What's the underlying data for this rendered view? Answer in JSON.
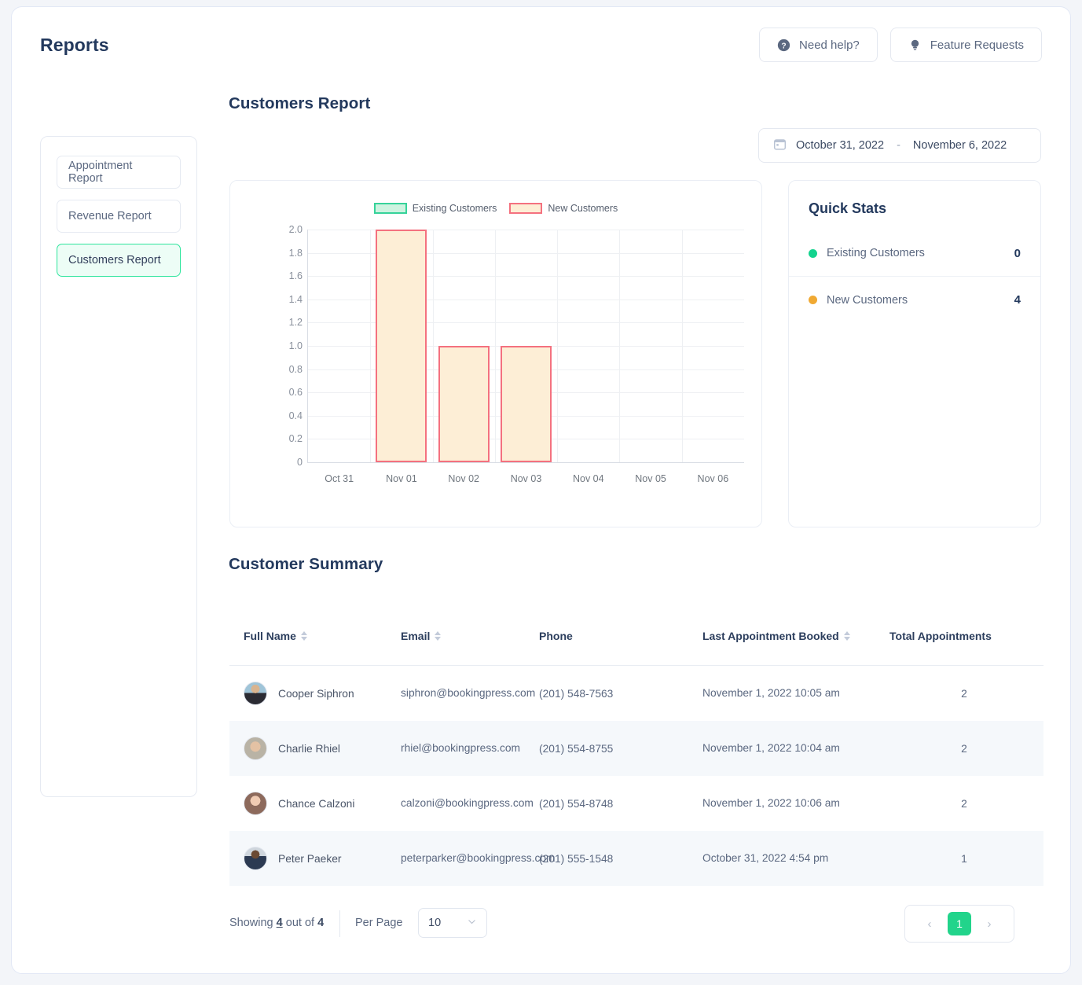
{
  "header": {
    "title": "Reports",
    "need_help_label": "Need help?",
    "feature_requests_label": "Feature Requests"
  },
  "sidebar": {
    "items": [
      {
        "label": "Appointment Report",
        "active": false
      },
      {
        "label": "Revenue Report",
        "active": false
      },
      {
        "label": "Customers Report",
        "active": true
      }
    ]
  },
  "main": {
    "report_title": "Customers Report",
    "summary_title": "Customer Summary"
  },
  "daterange": {
    "start": "October 31, 2022",
    "separator": "-",
    "end": "November 6, 2022"
  },
  "quick_stats": {
    "title": "Quick Stats",
    "rows": [
      {
        "label": "Existing Customers",
        "value": "0",
        "color": "#13d38e"
      },
      {
        "label": "New Customers",
        "value": "4",
        "color": "#f0a933"
      }
    ]
  },
  "chart_data": {
    "type": "bar",
    "title": "",
    "xlabel": "",
    "ylabel": "",
    "categories": [
      "Oct 31",
      "Nov 01",
      "Nov 02",
      "Nov 03",
      "Nov 04",
      "Nov 05",
      "Nov 06"
    ],
    "series": [
      {
        "name": "Existing Customers",
        "values": [
          0,
          0,
          0,
          0,
          0,
          0,
          0
        ],
        "fill": "#cdf3e0",
        "stroke": "#36d39a"
      },
      {
        "name": "New Customers",
        "values": [
          0,
          2,
          1,
          1,
          0,
          0,
          0
        ],
        "fill": "#fdeed6",
        "stroke": "#f4717f"
      }
    ],
    "ylim": [
      0,
      2.0
    ],
    "yticks": [
      "2.0",
      "1.8",
      "1.6",
      "1.4",
      "1.2",
      "1.0",
      "0.8",
      "0.6",
      "0.4",
      "0.2",
      "0"
    ],
    "ytick_values": [
      2.0,
      1.8,
      1.6,
      1.4,
      1.2,
      1.0,
      0.8,
      0.6,
      0.4,
      0.2,
      0
    ],
    "grid": true,
    "legend": [
      "Existing Customers",
      "New Customers"
    ],
    "legend_position": "top-center"
  },
  "table": {
    "columns": [
      {
        "label": "Full Name",
        "sortable": true
      },
      {
        "label": "Email",
        "sortable": true
      },
      {
        "label": "Phone",
        "sortable": false
      },
      {
        "label": "Last Appointment Booked",
        "sortable": true
      },
      {
        "label": "Total Appointments",
        "sortable": false
      }
    ],
    "rows": [
      {
        "name": "Cooper Siphron",
        "email": "siphron@bookingpress.com",
        "phone": "(201) 548-7563",
        "last_appointment": "November 1, 2022 10:05 am",
        "total": "2"
      },
      {
        "name": "Charlie Rhiel",
        "email": "rhiel@bookingpress.com",
        "phone": "(201) 554-8755",
        "last_appointment": "November 1, 2022 10:04 am",
        "total": "2"
      },
      {
        "name": "Chance Calzoni",
        "email": "calzoni@bookingpress.com",
        "phone": "(201) 554-8748",
        "last_appointment": "November 1, 2022 10:06 am",
        "total": "2"
      },
      {
        "name": "Peter Paeker",
        "email": "peterparker@bookingpress.com",
        "phone": "(201) 555-1548",
        "last_appointment": "October 31, 2022 4:54 pm",
        "total": "1"
      }
    ]
  },
  "footer": {
    "showing_prefix": "Showing",
    "showing_count": "4",
    "showing_middle": "out of",
    "showing_total": "4",
    "per_page_label": "Per Page",
    "per_page_value": "10",
    "page_current": "1",
    "prev_label": "‹",
    "next_label": "›"
  }
}
